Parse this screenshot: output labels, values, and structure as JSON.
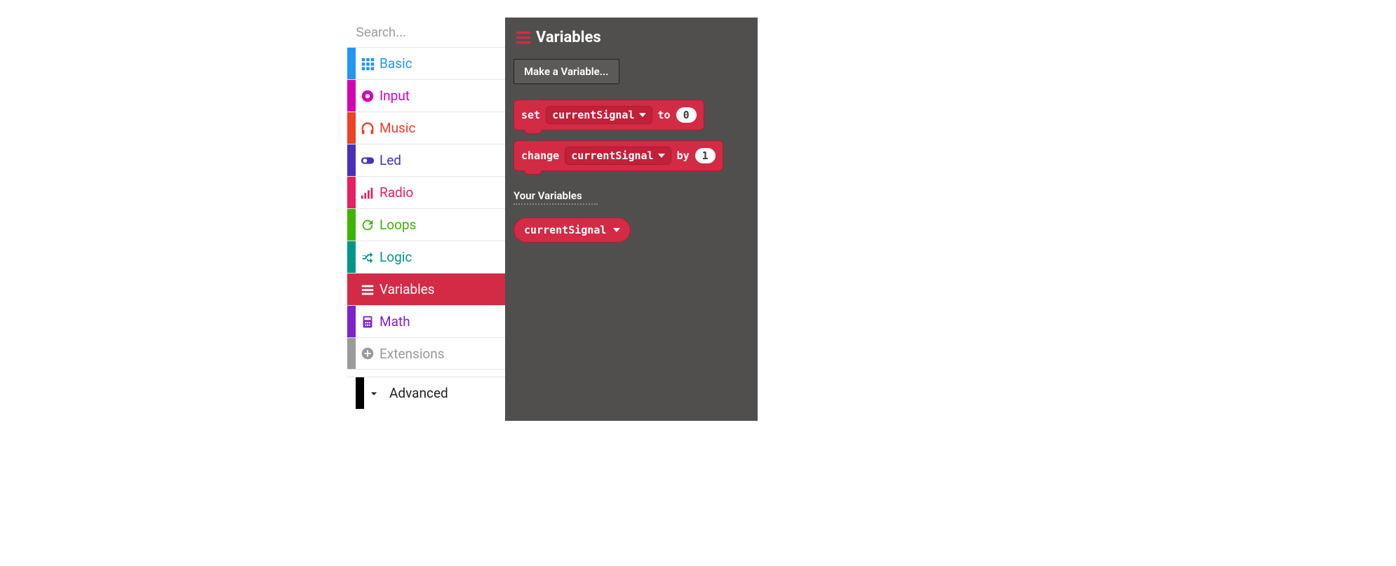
{
  "search": {
    "placeholder": "Search..."
  },
  "categories": [
    {
      "id": "basic",
      "label": "Basic",
      "color": "#2196f3",
      "icon": "grid"
    },
    {
      "id": "input",
      "label": "Input",
      "color": "#d500b6",
      "icon": "circle-dot"
    },
    {
      "id": "music",
      "label": "Music",
      "color": "#ef4124",
      "icon": "headphones"
    },
    {
      "id": "led",
      "label": "Led",
      "color": "#4b2fb9",
      "icon": "toggle"
    },
    {
      "id": "radio",
      "label": "Radio",
      "color": "#e91e63",
      "icon": "signal"
    },
    {
      "id": "loops",
      "label": "Loops",
      "color": "#3cb400",
      "icon": "redo"
    },
    {
      "id": "logic",
      "label": "Logic",
      "color": "#009688",
      "icon": "shuffle"
    },
    {
      "id": "variables",
      "label": "Variables",
      "color": "#d32a45",
      "icon": "list"
    },
    {
      "id": "math",
      "label": "Math",
      "color": "#7e22ce",
      "icon": "calculator"
    },
    {
      "id": "extensions",
      "label": "Extensions",
      "color": "#9a9a9a",
      "icon": "plus-circle"
    }
  ],
  "active_category": "variables",
  "advanced_label": "Advanced",
  "flyout": {
    "title": "Variables",
    "make_button": "Make a Variable...",
    "set_block": {
      "prefix": "set",
      "variable": "currentSignal",
      "middle": "to",
      "value": "0"
    },
    "change_block": {
      "prefix": "change",
      "variable": "currentSignal",
      "middle": "by",
      "value": "1"
    },
    "your_variables_label": "Your Variables",
    "user_variable": "currentSignal"
  }
}
